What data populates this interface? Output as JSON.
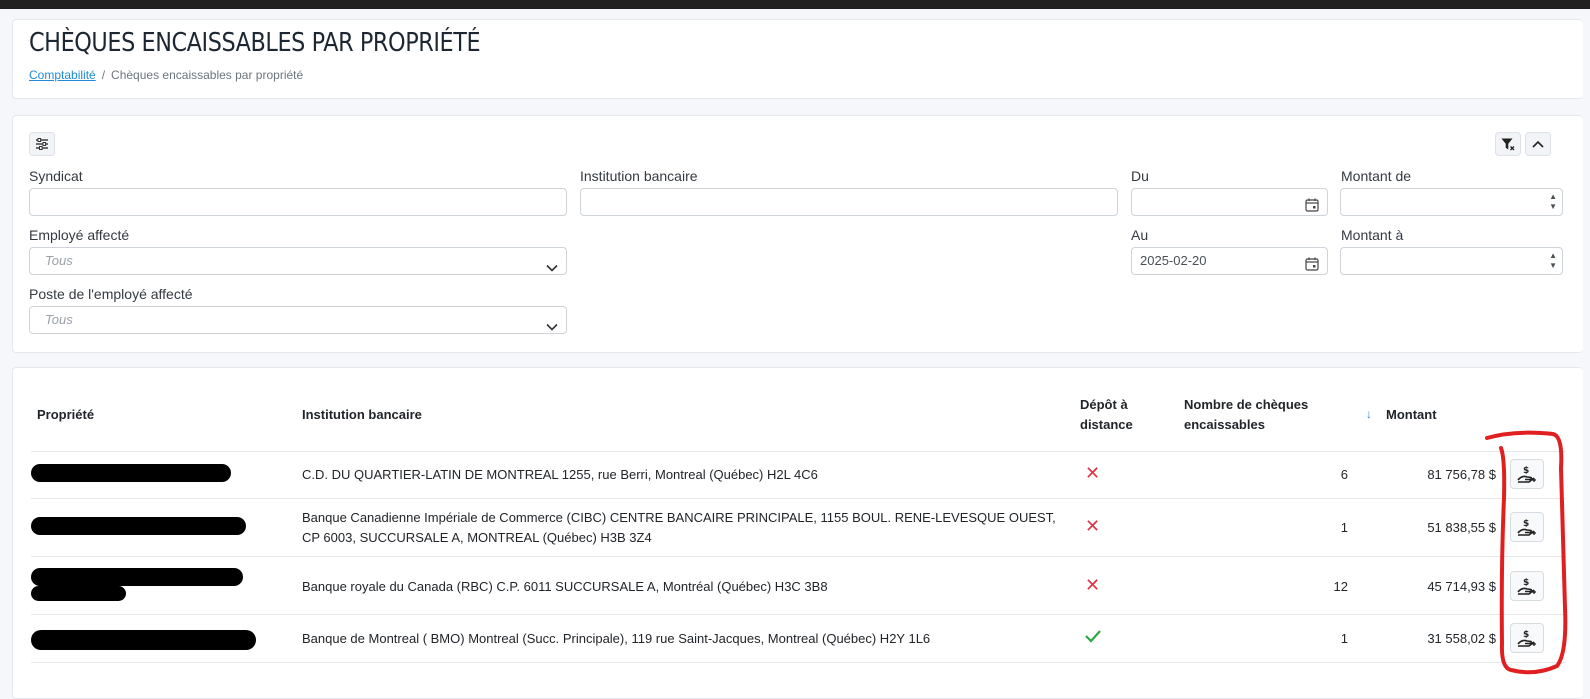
{
  "header": {
    "title": "CHÈQUES ENCAISSABLES PAR PROPRIÉTÉ",
    "breadcrumb": {
      "link": "Comptabilité",
      "separator": "/",
      "current": "Chèques encaissables par propriété"
    }
  },
  "filters": {
    "syndicat_label": "Syndicat",
    "institution_label": "Institution bancaire",
    "du_label": "Du",
    "montant_de_label": "Montant de",
    "employe_label": "Employé affecté",
    "employe_value": "Tous",
    "au_label": "Au",
    "au_value": "2025-02-20",
    "montant_a_label": "Montant à",
    "poste_label": "Poste de l'employé affecté",
    "poste_value": "Tous",
    "icons": [
      "sliders-icon",
      "filter-clear-icon",
      "chevron-up-icon",
      "calendar-icon",
      "chevron-down-icon"
    ]
  },
  "table": {
    "headers": {
      "propriete": "Propriété",
      "institution": "Institution bancaire",
      "depot_line1": "Dépôt à",
      "depot_line2": "distance",
      "nombre_line1": "Nombre de chèques",
      "nombre_line2": "encaissables",
      "sort_arrow": "↓",
      "montant": "Montant"
    },
    "rows": [
      {
        "institution": "C.D. DU QUARTIER-LATIN DE MONTREAL 1255, rue Berri, Montreal (Québec) H2L 4C6",
        "remote_deposit": false,
        "count": "6",
        "amount": "81 756,78 $"
      },
      {
        "institution": "Banque Canadienne Impériale de Commerce (CIBC) CENTRE BANCAIRE PRINCIPALE, 1155 BOUL. RENE-LEVESQUE OUEST, CP 6003, SUCCURSALE A, MONTREAL (Québec) H3B 3Z4",
        "remote_deposit": false,
        "count": "1",
        "amount": "51 838,55 $"
      },
      {
        "institution": "Banque royale du Canada (RBC) C.P. 6011 SUCCURSALE A, Montréal (Québec) H3C 3B8",
        "remote_deposit": false,
        "count": "12",
        "amount": "45 714,93 $"
      },
      {
        "institution": "Banque de Montreal ( BMO) Montreal (Succ. Principale), 119 rue Saint-Jacques, Montreal (Québec) H2Y 1L6",
        "remote_deposit": true,
        "count": "1",
        "amount": "31 558,02 $"
      }
    ],
    "row_icons": {
      "remote_no": "x-mark-icon",
      "remote_yes": "checkmark-icon",
      "action": "deposit-cheque-icon"
    }
  },
  "colors": {
    "link": "#1f8bd6",
    "danger": "#dc3545",
    "success": "#28a745",
    "annotation": "#e02020",
    "redaction": "#000000"
  }
}
